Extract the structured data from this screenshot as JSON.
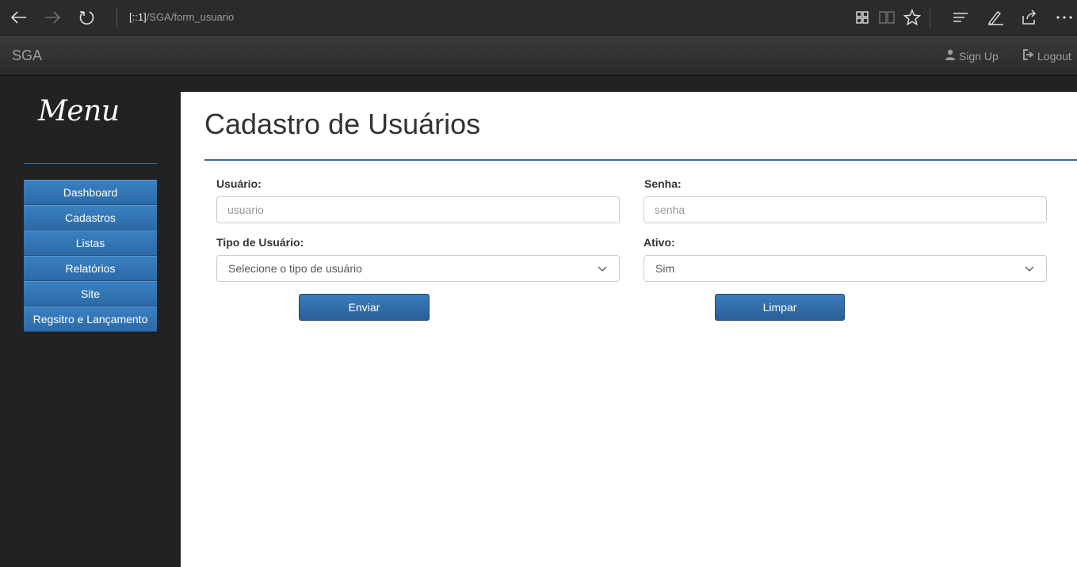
{
  "browser": {
    "address_host": "[::1]",
    "address_path": "/SGA/form_usuario",
    "icons": [
      "back-arrow-icon",
      "forward-arrow-icon",
      "refresh-icon",
      "extensions-icon",
      "reading-view-icon",
      "favorite-star-icon",
      "hub-icon",
      "web-note-icon",
      "share-icon",
      "more-icon"
    ]
  },
  "navbar": {
    "brand": "SGA",
    "signup_label": "Sign Up",
    "logout_label": "Logout"
  },
  "sidebar": {
    "title": "Menu",
    "items": [
      {
        "label": "Dashboard"
      },
      {
        "label": "Cadastros"
      },
      {
        "label": "Listas"
      },
      {
        "label": "Relatórios"
      },
      {
        "label": "Site"
      },
      {
        "label": "Regsitro e Lançamento"
      }
    ]
  },
  "main": {
    "title": "Cadastro de Usuários",
    "form": {
      "usuario_label": "Usuário:",
      "usuario_placeholder": "usuario",
      "senha_label": "Senha:",
      "senha_placeholder": "senha",
      "tipo_label": "Tipo de Usuário:",
      "tipo_selected": "Selecione o tipo de usuário",
      "ativo_label": "Ativo:",
      "ativo_selected": "Sim",
      "submit_label": "Enviar",
      "reset_label": "Limpar"
    }
  },
  "colors": {
    "accent": "#2c6aa8",
    "sidebar_bg": "#222222",
    "navbar_bg": "#2f2f2f"
  }
}
